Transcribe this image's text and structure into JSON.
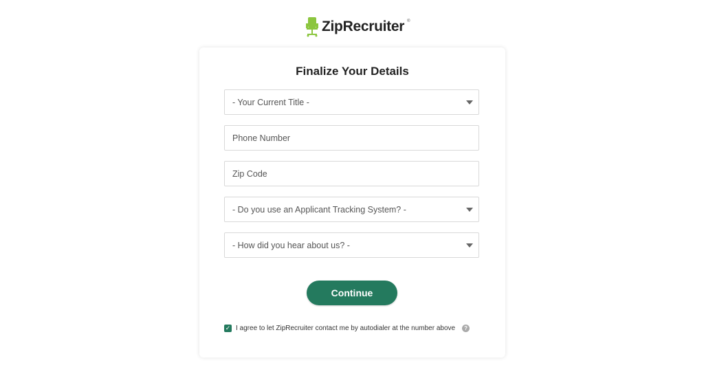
{
  "brand": {
    "name": "ZipRecruiter",
    "trademark": "®",
    "accent": "#8cc63f"
  },
  "form": {
    "title": "Finalize Your Details",
    "fields": [
      {
        "type": "select",
        "value": "- Your Current Title -"
      },
      {
        "type": "input",
        "placeholder": "Phone Number"
      },
      {
        "type": "input",
        "placeholder": "Zip Code"
      },
      {
        "type": "select",
        "value": "- Do you use an Applicant Tracking System? -"
      },
      {
        "type": "select",
        "value": "- How did you hear about us? -"
      }
    ],
    "continue_label": "Continue",
    "button_color": "#247a5e",
    "consent": {
      "checked": true,
      "label": "I agree to let ZipRecruiter contact me by autodialer at the number above",
      "help_icon": "?"
    }
  }
}
